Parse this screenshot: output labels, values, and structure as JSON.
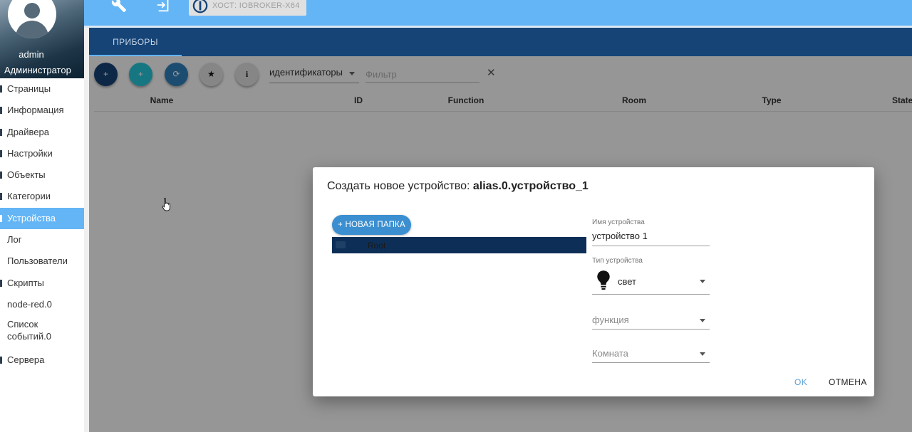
{
  "sidebar": {
    "user_name": "admin",
    "user_role": "Администратор",
    "items": [
      {
        "label": "Страницы"
      },
      {
        "label": "Информация"
      },
      {
        "label": "Драйвера"
      },
      {
        "label": "Настройки"
      },
      {
        "label": "Объекты"
      },
      {
        "label": "Категории"
      },
      {
        "label": "Устройства",
        "active": true
      },
      {
        "label": "Лог"
      },
      {
        "label": "Пользователи"
      },
      {
        "label": "Скрипты"
      },
      {
        "label": "node-red.0"
      },
      {
        "label_line1": "Список",
        "label_line2": "событий.0"
      },
      {
        "label": "Сервера"
      }
    ]
  },
  "topbar": {
    "icons": [
      "wrench-icon",
      "logout-icon"
    ],
    "host_label": "ХОСТ: IOBROKER-X64"
  },
  "tabs": [
    {
      "label": "ПРИБОРЫ"
    }
  ],
  "toolbar": {
    "buttons": [
      {
        "name": "add-device-button",
        "glyph": "+"
      },
      {
        "name": "add-button-teal",
        "glyph": "+"
      },
      {
        "name": "refresh-button",
        "glyph": "⟳"
      },
      {
        "name": "favorites-button",
        "glyph": "★"
      },
      {
        "name": "info-button",
        "glyph": "i"
      }
    ],
    "select_value": "идентификаторы",
    "filter_placeholder": "Фильтр",
    "clear_glyph": "✕"
  },
  "table": {
    "columns": [
      "Name",
      "ID",
      "Function",
      "Room",
      "Type",
      "States"
    ]
  },
  "dialog": {
    "title_prefix": "Создать новое устройство:",
    "title_id": "alias.0.устройство_1",
    "new_folder_label": "+ НОВАЯ ПАПКА",
    "folder_root_label": "Root",
    "fields": {
      "device_name": {
        "label": "Имя устройства",
        "value": "устройство 1"
      },
      "device_type": {
        "label": "Тип устройства",
        "value": "свет",
        "icon": "lightbulb-icon"
      },
      "function": {
        "placeholder": "функция"
      },
      "room": {
        "placeholder": "Комната"
      }
    },
    "ok_label": "OK",
    "cancel_label": "ОТМЕНА"
  },
  "colors": {
    "topbar": "#64b5f6",
    "tabbar": "#164477",
    "active_nav": "#64b5f6",
    "primary_button": "#3b8fd0",
    "teal": "#26c6da"
  }
}
